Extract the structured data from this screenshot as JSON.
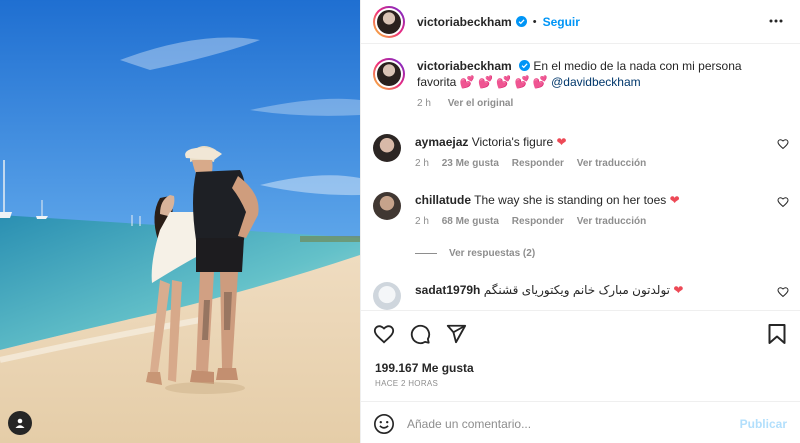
{
  "header": {
    "username": "victoriabeckham",
    "follow_label": "Seguir",
    "separator": "•"
  },
  "caption": {
    "username": "victoriabeckham",
    "text": "En el medio de la nada con mi persona favorita",
    "emojis": "💕 💕 💕 💕 💕",
    "mention": "@davidbeckham",
    "time": "2 h",
    "see_original": "Ver el original"
  },
  "comments": [
    {
      "username": "aymaejaz",
      "text": "Victoria's figure",
      "emoji": "❤",
      "time": "2 h",
      "likes": "23 Me gusta",
      "reply": "Responder",
      "translate": "Ver traducción"
    },
    {
      "username": "chillatude",
      "text": "The way she is standing on her toes",
      "emoji": "❤",
      "time": "2 h",
      "likes": "68 Me gusta",
      "reply": "Responder",
      "translate": "Ver traducción"
    },
    {
      "username": "sadat1979h",
      "text": "تولدتون مبارک خانم ویکتوریای قشنگم",
      "emoji": "❤",
      "time": "",
      "likes": "",
      "reply": "",
      "translate": ""
    }
  ],
  "view_replies": "Ver respuestas (2)",
  "likes_count": "199.167 Me gusta",
  "posted_ago": "HACE 2 HORAS",
  "comment_input": {
    "placeholder": "Añade un comentario...",
    "value": ""
  },
  "publish_label": "Publicar",
  "icons": {
    "verified": "verified-badge-icon",
    "more": "more-options-icon",
    "like": "heart-icon",
    "comment": "comment-icon",
    "share": "share-icon",
    "save": "bookmark-icon",
    "emoji": "emoji-icon",
    "tagged_user": "user-tag-icon"
  },
  "colors": {
    "accent": "#0095f6",
    "heart": "#ed4956",
    "muted": "#8e8e8e",
    "text": "#262626"
  }
}
